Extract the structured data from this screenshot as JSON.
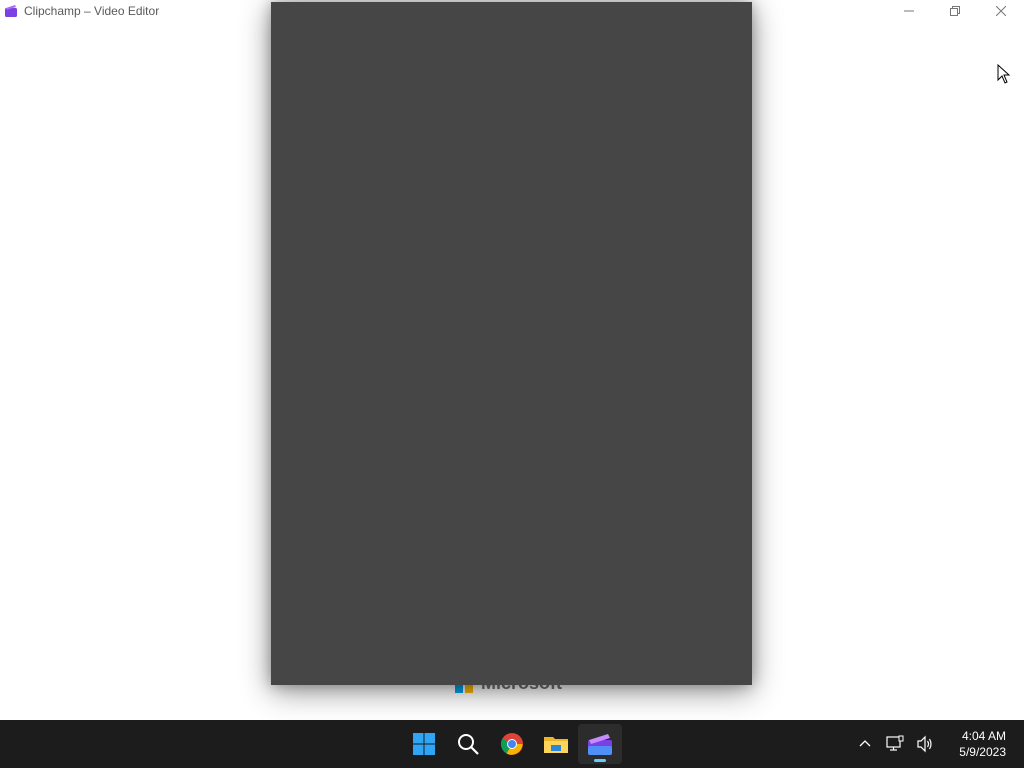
{
  "window": {
    "title": "Clipchamp – Video Editor",
    "icon": "clipchamp-icon"
  },
  "background": {
    "brand_text": "Microsoft"
  },
  "taskbar": {
    "apps": [
      "start-icon",
      "search-icon",
      "chrome-icon",
      "file-explorer-icon",
      "clipchamp-icon"
    ],
    "active_app": "clipchamp-icon",
    "clock_time": "4:04 AM",
    "clock_date": "5/9/2023",
    "tray_icons": [
      "chevron-up-icon",
      "network-icon",
      "volume-icon"
    ]
  }
}
